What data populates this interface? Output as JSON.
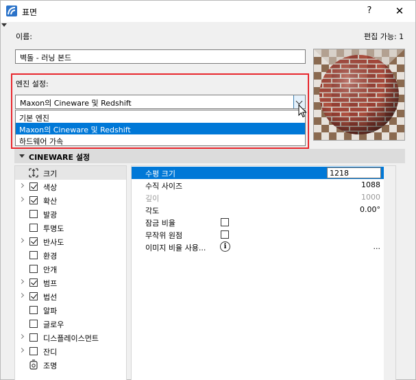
{
  "window": {
    "title": "표면",
    "help_label": "?",
    "close_label": "✕"
  },
  "name": {
    "label": "이름:",
    "value": "벽돌 - 러닝 본드",
    "editable_label": "편집 가능: 1"
  },
  "engine": {
    "label": "엔진 설정:",
    "selected": "Maxon의 Cineware 및 Redshift",
    "options": [
      "기본 엔진",
      "Maxon의 Cineware 및 Redshift",
      "하드웨어 가속"
    ],
    "selected_index": 1
  },
  "section": {
    "title": "CINEWARE 설정"
  },
  "tree": [
    {
      "label": "크기",
      "icon": "resize-icon",
      "checked": null,
      "expandable": false,
      "selected": true
    },
    {
      "label": "색상",
      "checked": true,
      "expandable": true
    },
    {
      "label": "확산",
      "checked": true,
      "expandable": true
    },
    {
      "label": "발광",
      "checked": false,
      "expandable": false
    },
    {
      "label": "투명도",
      "checked": false,
      "expandable": false
    },
    {
      "label": "반사도",
      "checked": true,
      "expandable": true
    },
    {
      "label": "환경",
      "checked": false,
      "expandable": false
    },
    {
      "label": "안개",
      "checked": false,
      "expandable": false
    },
    {
      "label": "범프",
      "checked": true,
      "expandable": true
    },
    {
      "label": "법선",
      "checked": true,
      "expandable": true
    },
    {
      "label": "알파",
      "checked": false,
      "expandable": false
    },
    {
      "label": "글로우",
      "checked": false,
      "expandable": false
    },
    {
      "label": "디스플레이스먼트",
      "checked": false,
      "expandable": true
    },
    {
      "label": "잔디",
      "checked": false,
      "expandable": true
    },
    {
      "label": "조명",
      "icon": "light-icon",
      "checked": null,
      "expandable": false
    }
  ],
  "properties": [
    {
      "name": "수평 크기",
      "value": "1218",
      "type": "input",
      "selected": true
    },
    {
      "name": "수직 사이즈",
      "value": "1088",
      "type": "text"
    },
    {
      "name": "깊이",
      "value": "1000",
      "type": "text",
      "disabled": true
    },
    {
      "name": "각도",
      "value": "0.00°",
      "type": "text"
    },
    {
      "name": "잠금 비율",
      "value": "",
      "type": "checkbox",
      "checked": false
    },
    {
      "name": "무작위 원점",
      "value": "",
      "type": "checkbox",
      "checked": false
    },
    {
      "name": "이미지 비율 사용...",
      "value": "...",
      "type": "info"
    }
  ],
  "colors": {
    "accent": "#0078d7",
    "highlight_border": "#e8262c",
    "brick": "#a5473a",
    "mortar": "#d8cfc4"
  }
}
